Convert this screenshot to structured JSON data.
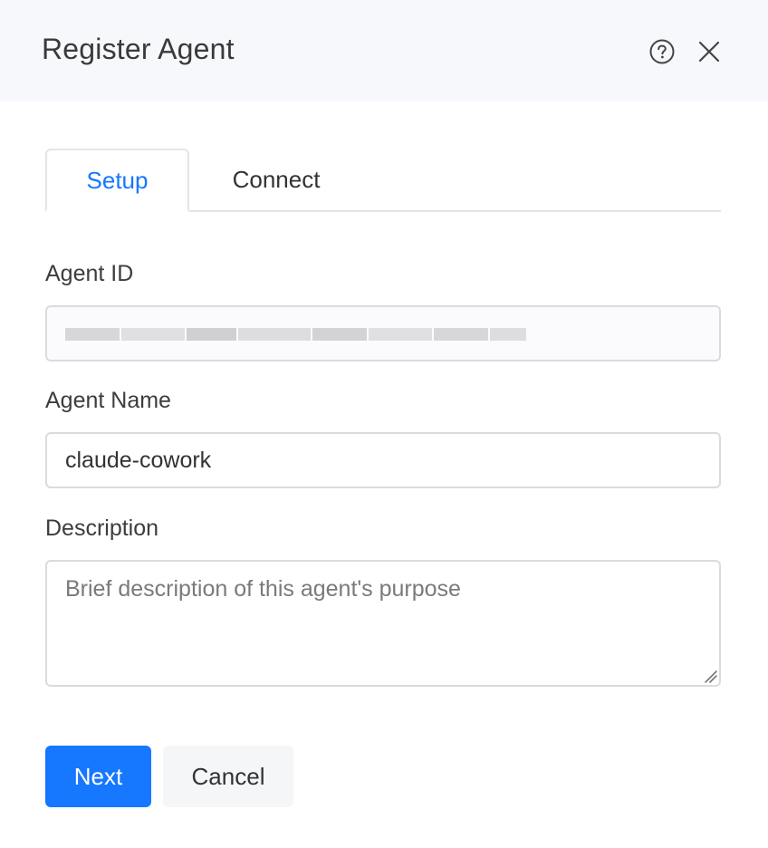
{
  "dialog": {
    "title": "Register Agent",
    "help_icon": "help-circle-icon",
    "close_icon": "close-icon"
  },
  "tabs": [
    {
      "label": "Setup",
      "active": true
    },
    {
      "label": "Connect",
      "active": false
    }
  ],
  "fields": {
    "agent_id": {
      "label": "Agent ID",
      "value": ""
    },
    "agent_name": {
      "label": "Agent Name",
      "value": "claude-cowork"
    },
    "description": {
      "label": "Description",
      "value": "",
      "placeholder": "Brief description of this agent's purpose"
    }
  },
  "buttons": {
    "next": "Next",
    "cancel": "Cancel"
  },
  "colors": {
    "accent": "#1677ff",
    "header_bg": "#f7f8fc",
    "border": "#d9dbe0"
  }
}
